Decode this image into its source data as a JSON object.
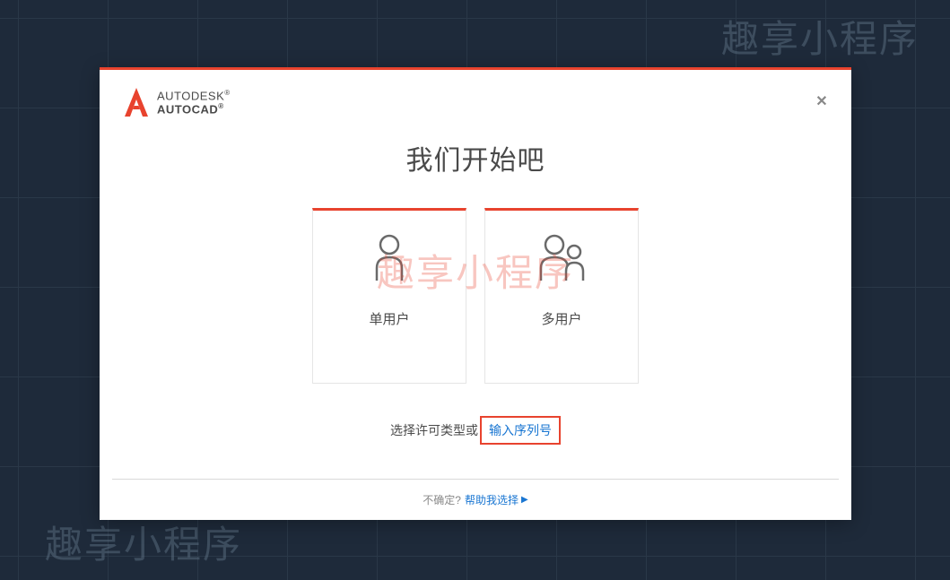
{
  "watermarks": {
    "top": "趣享小程序",
    "bottom": "趣享小程序",
    "center": "趣享小程序"
  },
  "logo": {
    "top_text": "AUTODESK",
    "bottom_text": "AUTOCAD"
  },
  "dialog": {
    "title": "我们开始吧",
    "cards": {
      "single_user": "单用户",
      "multi_user": "多用户"
    },
    "subtext": {
      "prefix": "选择许可类型或",
      "link": "输入序列号"
    }
  },
  "footer": {
    "text": "不确定?",
    "link": "帮助我选择"
  }
}
